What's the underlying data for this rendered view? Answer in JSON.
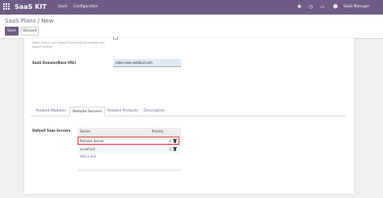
{
  "navbar": {
    "app_name": "SaaS KIT",
    "menu": [
      "SaaS",
      "Configuration"
    ],
    "user": "SaaS Manager"
  },
  "control_panel": {
    "breadcrumb_parent": "SaaS Plans",
    "breadcrumb_sep": "/",
    "breadcrumb_current": "New",
    "save_label": "Save",
    "discard_label": "Discard"
  },
  "form": {
    "pricing_note": "Note: Select user Based Pricing field to enable user based costing.",
    "domain_label": "SaaS Domain(Base URL)",
    "domain_value": "odoo-saas.webkul.com",
    "tabs": [
      "Related Modules",
      "Remote Servers",
      "Related Products",
      "Description"
    ],
    "active_tab": "Remote Servers",
    "servers_label": "Default Saas Servers",
    "table": {
      "col_server": "Server",
      "col_priority": "Priority",
      "rows": [
        {
          "server": "Remote Server",
          "priority": "1"
        },
        {
          "server": "Localhost",
          "priority": "2"
        }
      ],
      "add_line": "Add a line"
    }
  },
  "colors": {
    "brand": "#6f5b85",
    "highlight": "#e0312f"
  }
}
